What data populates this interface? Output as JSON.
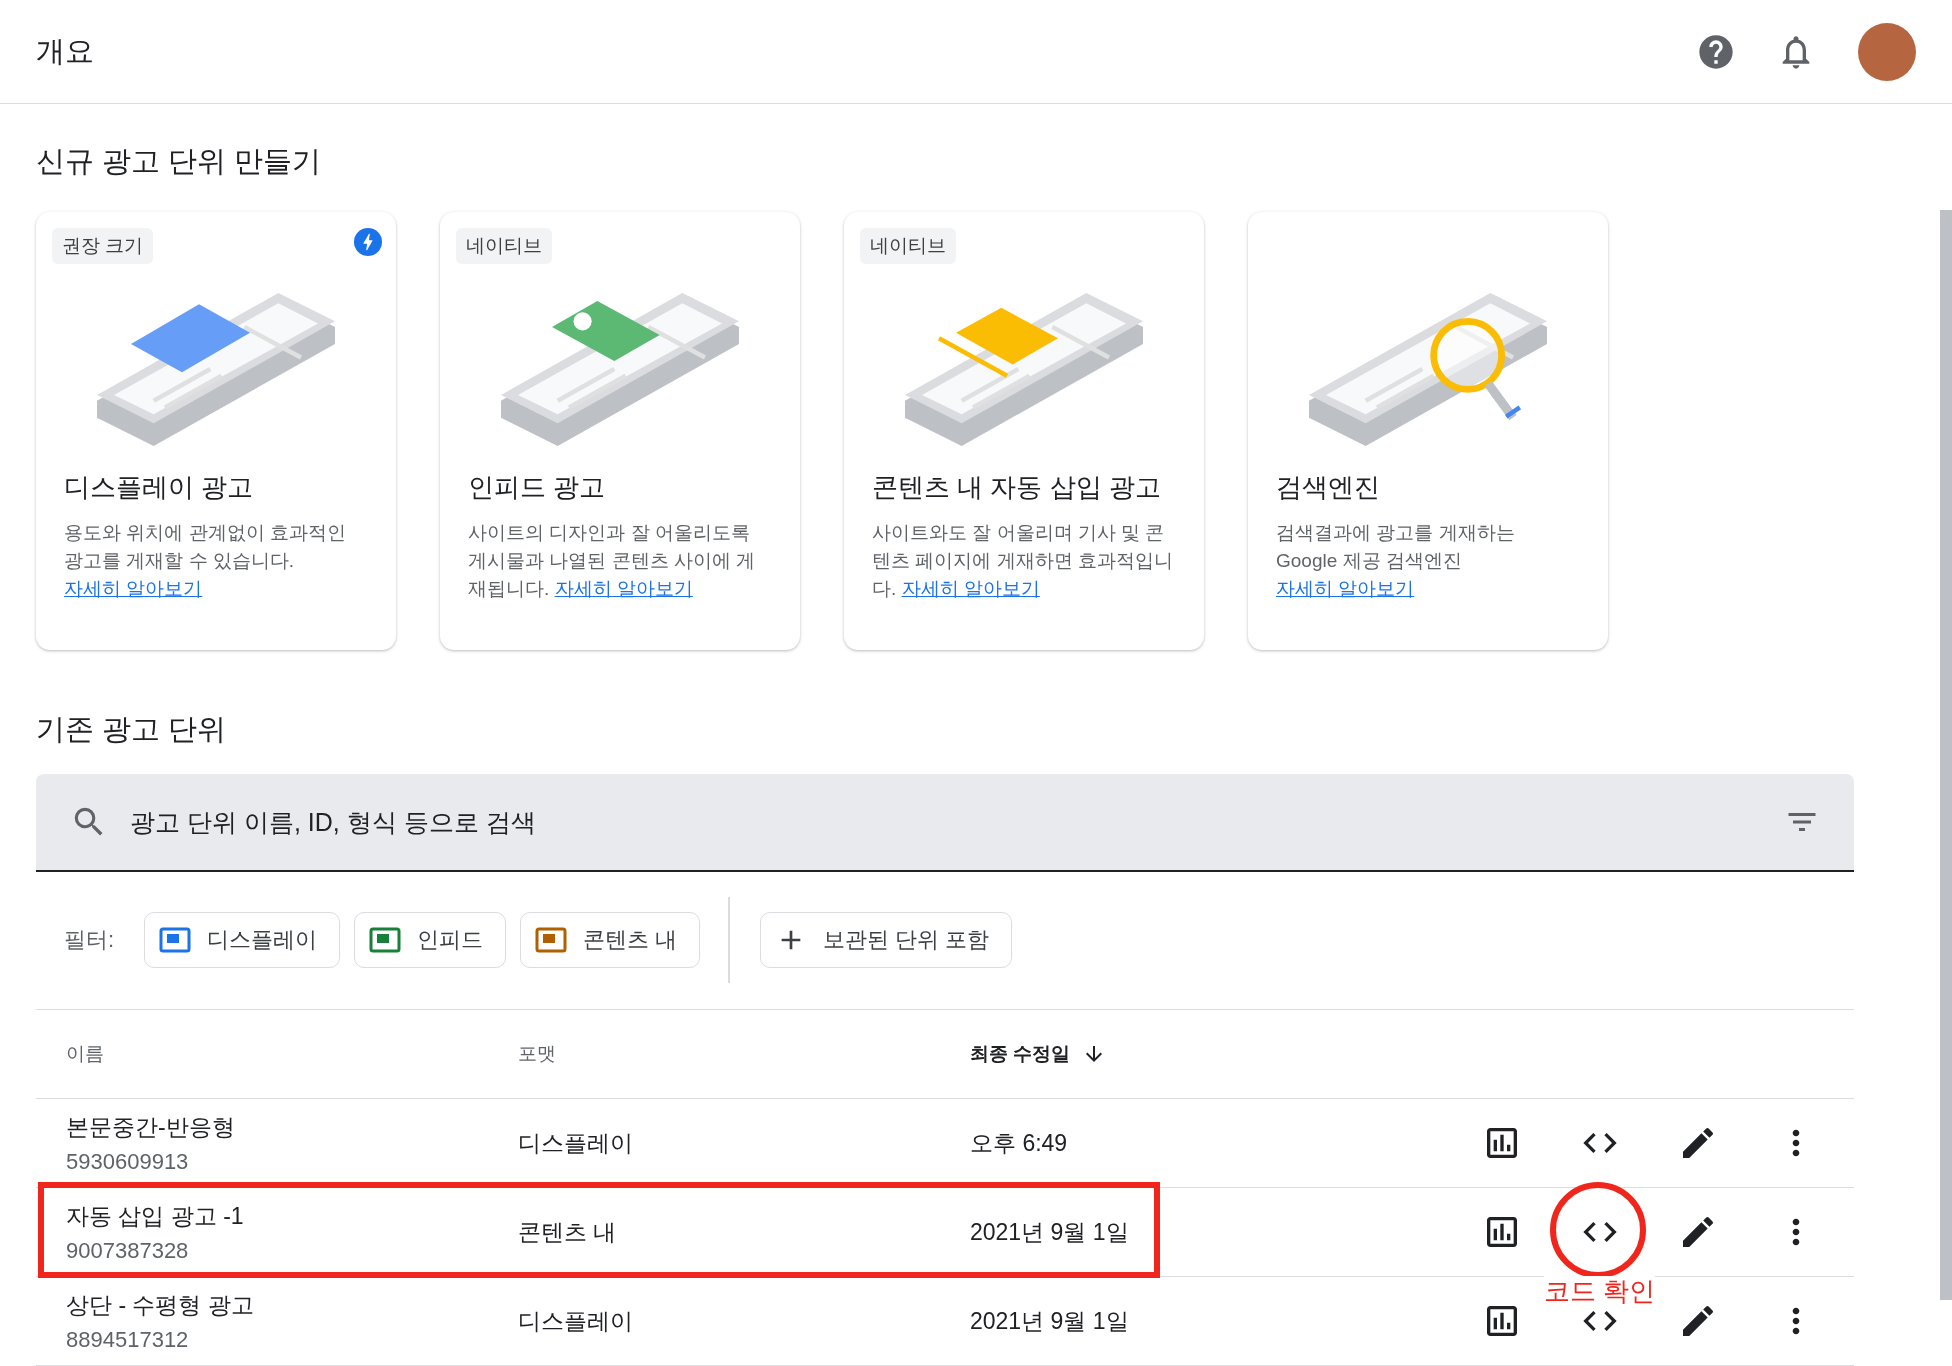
{
  "header": {
    "title": "개요"
  },
  "create_section": {
    "title": "신규 광고 단위 만들기",
    "cards": [
      {
        "kind": "display",
        "tag": "권장 크기",
        "amp": true,
        "title": "디스플레이 광고",
        "description": "용도와 위치에 관계없이 효과적인 광고를 게재할 수 있습니다. ",
        "link": "자세히 알아보기"
      },
      {
        "kind": "infeed",
        "tag": "네이티브",
        "amp": false,
        "title": "인피드 광고",
        "description": "사이트의 디자인과 잘 어울리도록 게시물과 나열된 콘텐츠 사이에 게재됩니다. ",
        "link": "자세히 알아보기"
      },
      {
        "kind": "inarticle",
        "tag": "네이티브",
        "amp": false,
        "title": "콘텐츠 내 자동 삽입 광고",
        "description": "사이트와도 잘 어울리며 기사 및 콘텐츠 페이지에 게재하면 효과적입니다. ",
        "link": "자세히 알아보기"
      },
      {
        "kind": "search",
        "title": "검색엔진",
        "amp": false,
        "description": "검색결과에 광고를 게재하는 Google 제공 검색엔진 ",
        "link": "자세히 알아보기"
      }
    ]
  },
  "existing_section": {
    "title": "기존 광고 단위",
    "search": {
      "placeholder": "광고 단위 이름, ID, 형식 등으로 검색"
    },
    "filter_label": "필터:",
    "filters": [
      {
        "label": "디스플레이",
        "color": "#1a73e8"
      },
      {
        "label": "인피드",
        "color": "#188038"
      },
      {
        "label": "콘텐츠 내",
        "color": "#b06000"
      }
    ],
    "archived_button": "보관된 단위 포함",
    "table": {
      "columns": [
        {
          "label": "이름",
          "sorted": false
        },
        {
          "label": "포맷",
          "sorted": false
        },
        {
          "label": "최종 수정일",
          "sorted": true
        }
      ],
      "rows": [
        {
          "name": "본문중간-반응형",
          "id": "5930609913",
          "format": "디스플레이",
          "modified": "오후 6:49",
          "highlighted": false
        },
        {
          "name": "자동 삽입 광고 -1",
          "id": "9007387328",
          "format": "콘텐츠 내",
          "modified": "2021년 9월 1일",
          "highlighted": true
        },
        {
          "name": "상단 - 수평형 광고",
          "id": "8894517312",
          "format": "디스플레이",
          "modified": "2021년 9월 1일",
          "highlighted": false
        }
      ]
    }
  },
  "annotation": {
    "text": "코드 확인"
  }
}
